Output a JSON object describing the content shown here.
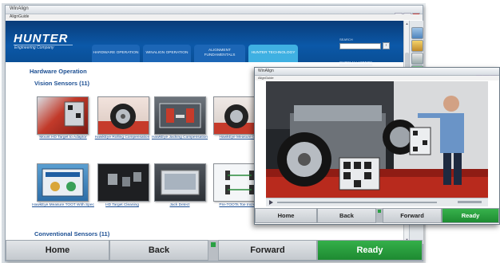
{
  "main_window": {
    "title": "WinAlign",
    "menu": "AlignGuide",
    "window_buttons": [
      "_",
      "□",
      "×"
    ],
    "logo": "HUNTER",
    "logo_subtitle": "Engineering Company",
    "tabs": [
      {
        "label": "HARDWARE OPERATION",
        "active": false
      },
      {
        "label": "WINALIGN OPERATION",
        "active": false
      },
      {
        "label": "ALIGNMENT FUNDAMENTALS",
        "active": false
      },
      {
        "label": "HUNTER TECHNOLOGY",
        "active": true
      }
    ],
    "search_label": "SEARCH",
    "show_all": "SHOW ALL VIDEOS",
    "section_title": "Hardware Operation",
    "subsection_title": "Vision Sensors (11)",
    "videos": [
      {
        "caption": "Mount HD Target to Adaptor",
        "thumb": "target-adaptor"
      },
      {
        "caption": "HawkEye Rolling Compensation",
        "thumb": "wheel"
      },
      {
        "caption": "HawkEye Jacking Compensation",
        "thumb": "lift"
      },
      {
        "caption": "HawkEye Measure C...",
        "thumb": "wheel2"
      },
      {
        "caption": "HawkEye Measure TOOT With Spec",
        "thumb": "screen"
      },
      {
        "caption": "HD Target Cleaning",
        "thumb": "dark"
      },
      {
        "caption": "Jack Detect",
        "thumb": "screen2"
      },
      {
        "caption": "Pre-TOOTs Toe Incre...",
        "thumb": "diagram"
      }
    ],
    "subsection2_title": "Conventional Sensors (11)",
    "bottom_buttons": {
      "home": "Home",
      "back": "Back",
      "forward": "Forward",
      "ready": "Ready"
    }
  },
  "video_window": {
    "title": "WinAlign",
    "menu": "AlignGuide",
    "bottom_buttons": {
      "home": "Home",
      "back": "Back",
      "forward": "Forward",
      "ready": "Ready"
    }
  },
  "colors": {
    "accent": "#0b58a8",
    "active_tab": "#3fb0e2",
    "ready": "#1e8a32",
    "link": "#1b4e92"
  }
}
